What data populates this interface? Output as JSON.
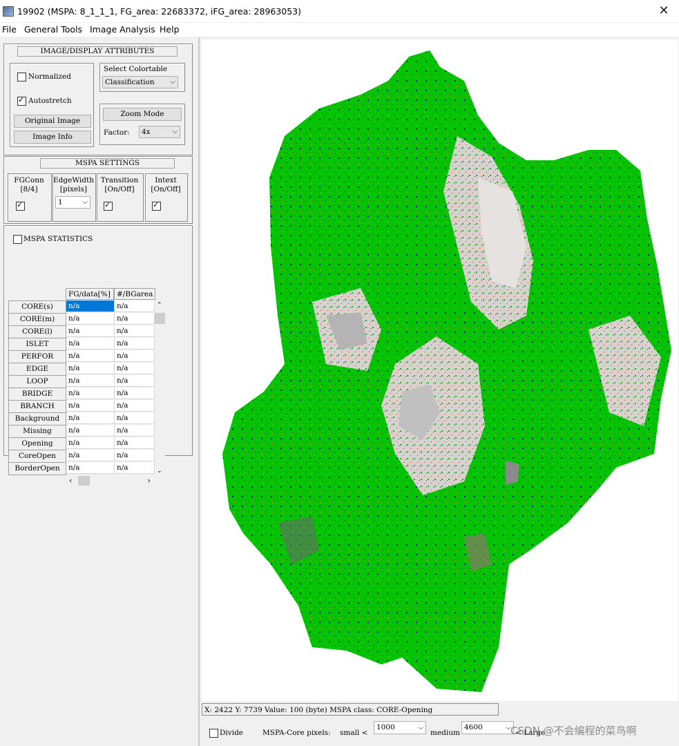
{
  "window": {
    "title": "19902 (MSPA: 8_1_1_1, FG_area: 22683372, iFG_area: 28963053)",
    "close_glyph": "✕"
  },
  "menu": {
    "items": [
      "File",
      "General Tools",
      "Image Analysis",
      "Help"
    ]
  },
  "display": {
    "header": "IMAGE/DISPLAY ATTRIBUTES",
    "normalized_label": "Normalized",
    "normalized_checked": false,
    "autostretch_label": "Autostretch",
    "autostretch_checked": true,
    "original_image_button": "Original Image",
    "image_info_button": "Image Info",
    "select_colortable_label": "Select Colortable",
    "colortable_value": "Classification",
    "zoom_mode_button": "Zoom Mode",
    "factor_label": "Factor:",
    "factor_value": "4x"
  },
  "mspa_settings": {
    "header": "MSPA SETTINGS",
    "fgconn_label": [
      "FGConn",
      "[8/4]"
    ],
    "fgconn_checked": true,
    "edgewidth_label": [
      "EdgeWidth",
      "[pixels]"
    ],
    "edgewidth_value": "1",
    "transition_label": [
      "Transition",
      "[On/Off]"
    ],
    "transition_checked": true,
    "intext_label": [
      "Intext",
      "[On/Off]"
    ],
    "intext_checked": true
  },
  "mspa_statistics": {
    "label": "MSPA STATISTICS",
    "checked": false,
    "columns": [
      "FG/data[%]",
      "#/BGarea"
    ],
    "rows": [
      {
        "name": "CORE(s)",
        "v1": "n/a",
        "v2": "n/a"
      },
      {
        "name": "CORE(m)",
        "v1": "n/a",
        "v2": "n/a"
      },
      {
        "name": "CORE(l)",
        "v1": "n/a",
        "v2": "n/a"
      },
      {
        "name": "ISLET",
        "v1": "n/a",
        "v2": "n/a"
      },
      {
        "name": "PERFOR",
        "v1": "n/a",
        "v2": "n/a"
      },
      {
        "name": "EDGE",
        "v1": "n/a",
        "v2": "n/a"
      },
      {
        "name": "LOOP",
        "v1": "n/a",
        "v2": "n/a"
      },
      {
        "name": "BRIDGE",
        "v1": "n/a",
        "v2": "n/a"
      },
      {
        "name": "BRANCH",
        "v1": "n/a",
        "v2": "n/a"
      },
      {
        "name": "Background",
        "v1": "n/a",
        "v2": "n/a"
      },
      {
        "name": "Missing",
        "v1": "n/a",
        "v2": "n/a"
      },
      {
        "name": "Opening",
        "v1": "n/a",
        "v2": "n/a"
      },
      {
        "name": "CoreOpen",
        "v1": "n/a",
        "v2": "n/a"
      },
      {
        "name": "BorderOpen",
        "v1": "n/a",
        "v2": "n/a"
      }
    ]
  },
  "status": {
    "text": "X: 2422   Y: 7739   Value: 100 (byte)     MSPA class: CORE-Opening"
  },
  "bottom": {
    "divide_label": "Divide",
    "divide_checked": false,
    "core_pixels_label": "MSPA-Core pixels:",
    "small_label": "small <",
    "small_value": "1000",
    "medium_label": "medium",
    "medium_value": "4600",
    "large_label": "< Large"
  },
  "watermark": "CSDN @不会编程的菜鸟啊",
  "colors": {
    "core": "#00c400",
    "background": "#d7d2d0",
    "opening": "#b4b4b4",
    "edge": "#1b1b8c",
    "bridge": "#d23c00",
    "selection": "#0078d7"
  }
}
